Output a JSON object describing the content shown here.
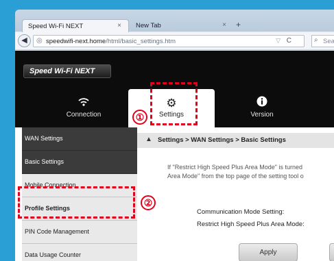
{
  "browser": {
    "active_tab": "Speed Wi-Fi NEXT",
    "inactive_tab": "New Tab",
    "tab_close": "×",
    "new_tab_symbol": "+",
    "back_symbol": "◀",
    "url_host": "speedwifi-next.home",
    "url_path": "/html/basic_settings.htm",
    "reload_symbol": "C",
    "dropdown_symbol": "▽",
    "search_placeholder": "Sea"
  },
  "header": {
    "logo": "Speed Wi-Fi NEXT",
    "menu": [
      {
        "label": "Connection",
        "icon": "wifi-icon"
      },
      {
        "label": "Settings",
        "icon": "gear-icon"
      },
      {
        "label": "Version",
        "icon": "info-icon"
      }
    ]
  },
  "sidebar": {
    "items": [
      {
        "label": "WAN Settings"
      },
      {
        "label": "Basic Settings"
      },
      {
        "label": "Mobile Connection"
      },
      {
        "label": "Profile Settings"
      },
      {
        "label": "PIN Code Management"
      },
      {
        "label": "Data Usage Counter"
      }
    ]
  },
  "content": {
    "breadcrumb": "Settings > WAN Settings > Basic Settings",
    "info_line1": "If \"Restrict High Speed Plus Area Mode\" is turned",
    "info_line2": "Area Mode\" from the top page of the setting tool o",
    "label_comm_mode": "Communication Mode Setting:",
    "label_restrict": "Restrict High Speed Plus Area Mode:",
    "apply_button": "Apply"
  },
  "annotations": {
    "marker1": "①",
    "marker2": "②",
    "color": "#e2001a"
  },
  "colors": {
    "background": "#2a9fd6",
    "header_black": "#0c0c0c"
  }
}
